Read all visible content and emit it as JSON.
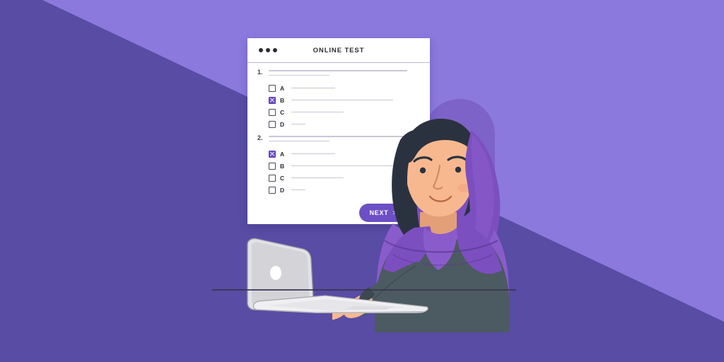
{
  "theme": {
    "bg_light": "#8b79dd",
    "bg_dark": "#584ca4",
    "accent_purple": "#6c4fc4",
    "halo_purple": "#7d63c8",
    "card_bg": "#ffffff",
    "text_dark": "#2b2b35",
    "line_gray": "#c9c6d6",
    "skin": "#f5b48c",
    "hair": "#2b323f",
    "hijab": "#7c4fc0",
    "sweater": "#4c5a61",
    "laptop_body": "#d8d8dc"
  },
  "card": {
    "title": "ONLINE TEST",
    "window_dots": [
      "dot-1",
      "dot-2",
      "dot-3"
    ],
    "questions": [
      {
        "number": "1.",
        "prompt_line_widths": [
          196,
          86
        ],
        "options": [
          {
            "letter": "A",
            "checked": false,
            "line_width": 62
          },
          {
            "letter": "B",
            "checked": true,
            "line_width": 144
          },
          {
            "letter": "C",
            "checked": false,
            "line_width": 74
          },
          {
            "letter": "D",
            "checked": false,
            "line_width": 20
          }
        ]
      },
      {
        "number": "2.",
        "prompt_line_widths": [
          196,
          86
        ],
        "options": [
          {
            "letter": "A",
            "checked": true,
            "line_width": 62
          },
          {
            "letter": "B",
            "checked": false,
            "line_width": 144
          },
          {
            "letter": "C",
            "checked": false,
            "line_width": 74
          },
          {
            "letter": "D",
            "checked": false,
            "line_width": 20
          }
        ]
      }
    ],
    "next_button": {
      "label": "NEXT",
      "chevron": ">"
    }
  },
  "illustration": {
    "scene": "woman-taking-online-test-on-laptop",
    "character": "woman-with-hijab",
    "device": "laptop",
    "surface": "desk"
  }
}
